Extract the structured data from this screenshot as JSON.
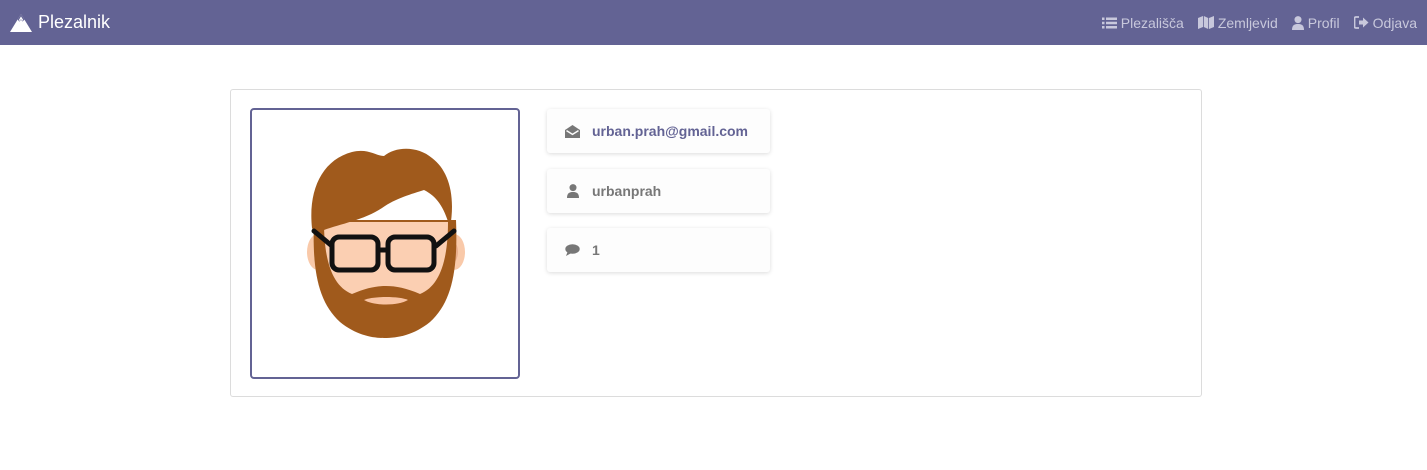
{
  "navbar": {
    "brand": "Plezalnik",
    "links": [
      {
        "label": "Plezališča",
        "icon": "list-icon"
      },
      {
        "label": "Zemljevid",
        "icon": "map-icon"
      },
      {
        "label": "Profil",
        "icon": "user-icon"
      },
      {
        "label": "Odjava",
        "icon": "sign-out-icon"
      }
    ]
  },
  "profile": {
    "avatar_icon": "bearded-man-avatar",
    "email": "urban.prah@gmail.com",
    "username": "urbanprah",
    "comments": "1"
  },
  "colors": {
    "navbar": "#636394",
    "accent": "#636394",
    "muted_text": "#777777"
  }
}
